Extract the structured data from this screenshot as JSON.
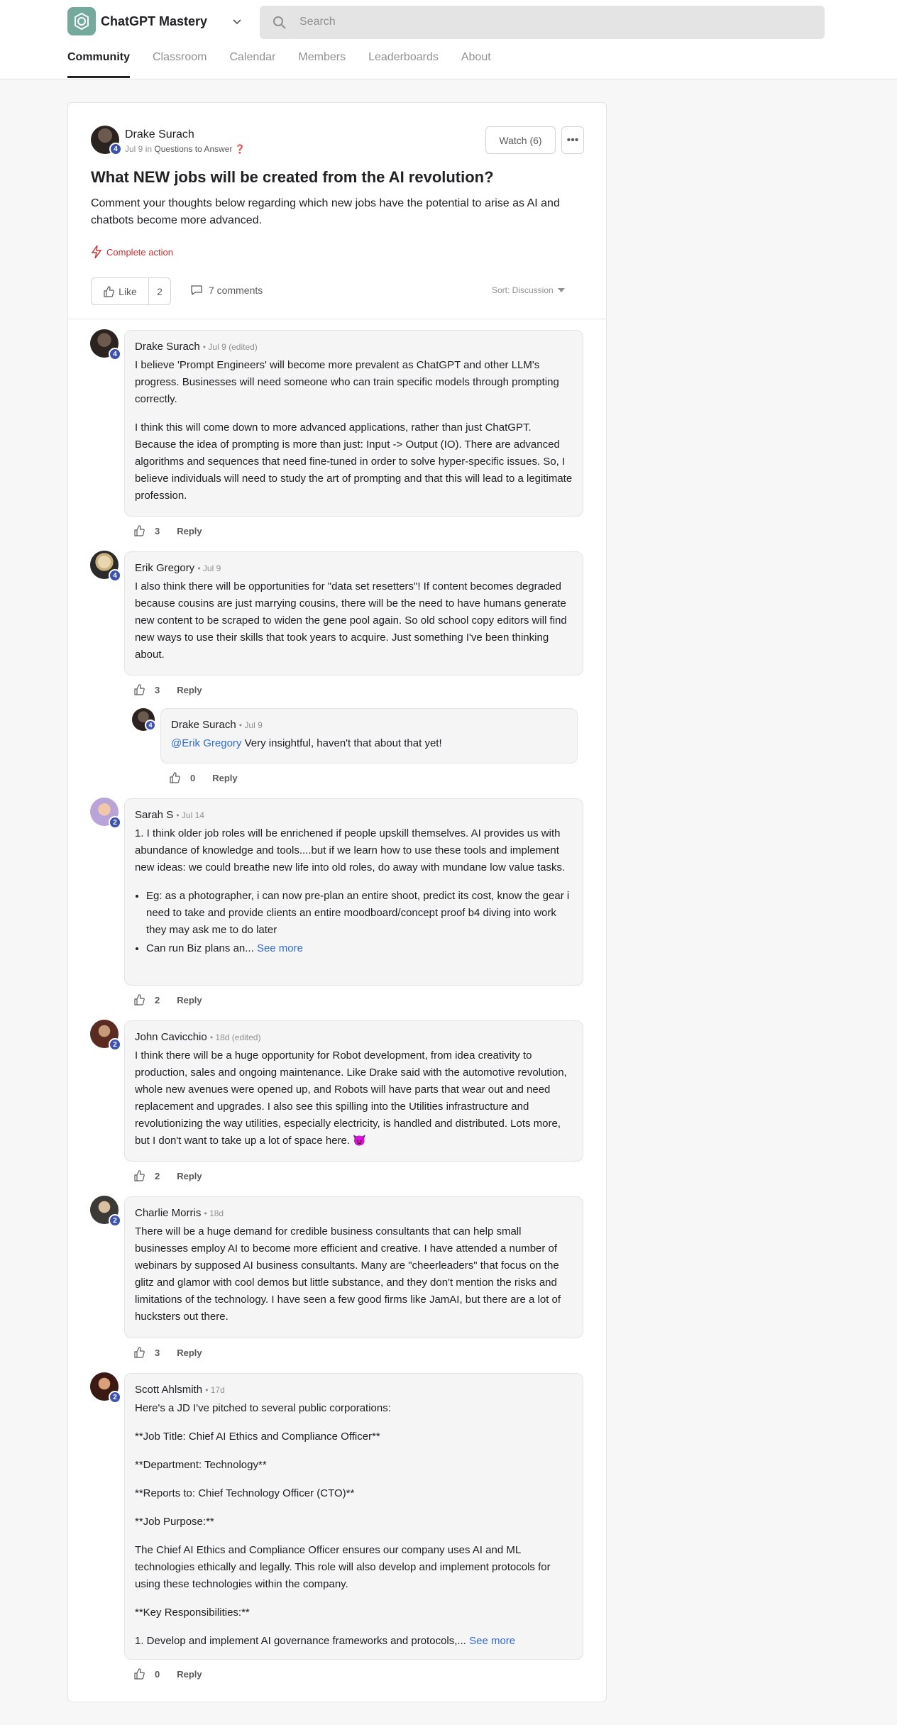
{
  "header": {
    "app_title": "ChatGPT Mastery",
    "search_placeholder": "Search",
    "tabs": [
      {
        "label": "Community",
        "active": true
      },
      {
        "label": "Classroom"
      },
      {
        "label": "Calendar"
      },
      {
        "label": "Members"
      },
      {
        "label": "Leaderboards"
      },
      {
        "label": "About"
      }
    ]
  },
  "post": {
    "author": "Drake Surach",
    "level": "4",
    "date": "Jul 9",
    "in_text": "in",
    "category": "Questions to Answer",
    "category_icon": "❓",
    "watch_label": "Watch (6)",
    "more_label": "•••",
    "title": "What NEW jobs will be created from the AI revolution?",
    "body": "Comment your thoughts below regarding which new jobs have the potential to arise as AI and chatbots become more advanced.",
    "action_label": "Complete action",
    "like_label": "Like",
    "like_count": "2",
    "comments_label": "7 comments",
    "sort_label": "Sort: Discussion"
  },
  "comments": [
    {
      "author": "Drake Surach",
      "level": "4",
      "time": "• Jul 9 (edited)",
      "paragraphs": [
        "I believe 'Prompt Engineers' will become more prevalent as ChatGPT and other LLM's progress. Businesses will need someone who can train specific models through prompting correctly.",
        "I think this will come down to more advanced applications, rather than just ChatGPT. Because the idea of prompting is more than just: Input -> Output (IO). There are advanced algorithms and sequences that need fine-tuned in order to solve hyper-specific issues. So, I believe individuals will need to study the art of prompting and that this will lead to a legitimate profession."
      ],
      "likes": "3",
      "reply_label": "Reply"
    },
    {
      "author": "Erik Gregory",
      "level": "4",
      "time": "• Jul 9",
      "paragraphs": [
        "I also think there will be opportunities for \"data set resetters\"! If content becomes degraded because cousins are just marrying cousins, there will be the need to have humans generate new content to be scraped to widen the gene pool again. So old school copy editors will find new ways to use their skills that took years to acquire. Just something I've been thinking about."
      ],
      "likes": "3",
      "reply_label": "Reply"
    },
    {
      "author": "Drake Surach",
      "level": "4",
      "time": "• Jul 9",
      "mention": "@Erik Gregory",
      "text": " Very insightful, haven't that about that yet!",
      "likes": "0",
      "reply_label": "Reply"
    },
    {
      "author": "Sarah S",
      "level": "2",
      "time": "• Jul 14",
      "paragraphs": [
        "1. I think older job roles will be enrichened if people upskill themselves. AI provides us with abundance of knowledge and tools....but if we learn how to use these tools and implement new ideas: we could breathe new life into old roles, do away with mundane low value tasks."
      ],
      "bullets": [
        "Eg: as a photographer, i can now pre-plan an entire shoot, predict its cost, know the gear i need to take and provide clients an entire moodboard/concept proof b4 diving into work they may ask me to do later",
        "Can run Biz plans an..."
      ],
      "see_more": "See more",
      "likes": "2",
      "reply_label": "Reply"
    },
    {
      "author": "John Cavicchio",
      "level": "2",
      "time": "• 18d (edited)",
      "paragraphs": [
        "I think there will be a huge opportunity for Robot development, from idea creativity to production, sales and ongoing maintenance. Like Drake said with the automotive revolution, whole new avenues were opened up, and Robots will have parts that wear out and need replacement and upgrades. I also see this spilling into the Utilities infrastructure and revolutionizing the way utilities, especially electricity, is handled and distributed. Lots more, but I don't want to take up a lot of space here. 😈"
      ],
      "likes": "2",
      "reply_label": "Reply"
    },
    {
      "author": "Charlie Morris",
      "level": "2",
      "time": "• 18d",
      "paragraphs": [
        "There will be a huge demand for credible business consultants that can help small businesses employ AI to become more efficient and creative. I have attended a number of webinars by supposed AI business consultants. Many are \"cheerleaders\" that focus on the glitz and glamor with cool demos but little substance, and they don't mention the risks and limitations of the technology. I have seen a few good firms like JamAI, but there are a lot of hucksters out there."
      ],
      "likes": "3",
      "reply_label": "Reply"
    },
    {
      "author": "Scott Ahlsmith",
      "level": "2",
      "time": "• 17d",
      "paragraphs": [
        "Here's a JD I've pitched to several public corporations:",
        "**Job Title: Chief AI Ethics and Compliance Officer**",
        "**Department: Technology**",
        "**Reports to: Chief Technology Officer (CTO)**",
        "**Job Purpose:**",
        "The Chief AI Ethics and Compliance Officer ensures our company uses AI and ML technologies ethically and legally. This role will also develop and implement protocols for using these technologies within the company.",
        "**Key Responsibilities:**"
      ],
      "last_line": "1. Develop and implement AI governance frameworks and protocols,...",
      "see_more": "See more",
      "likes": "0",
      "reply_label": "Reply"
    }
  ],
  "colors": {
    "accent": "#3c52b3",
    "link": "#2f6be0",
    "action": "#d32f2f",
    "logo": "#74aa9c"
  }
}
